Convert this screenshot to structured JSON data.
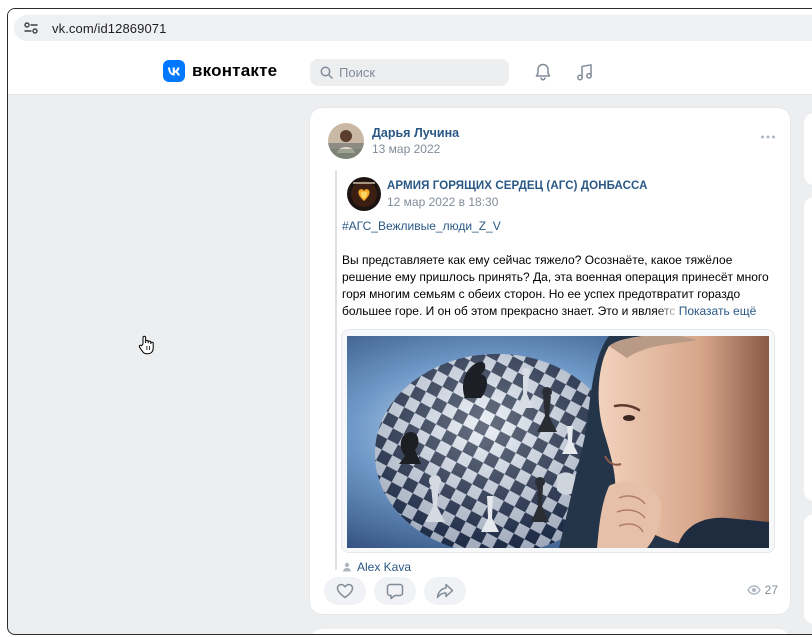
{
  "browser": {
    "url": "vk.com/id12869071"
  },
  "header": {
    "logo_text": "вконтакте",
    "search_placeholder": "Поиск"
  },
  "post": {
    "author": "Дарья Лучина",
    "date": "13 мар 2022",
    "repost": {
      "group_name": "АРМИЯ ГОРЯЩИХ СЕРДЕЦ (АГС) ДОНБАССА",
      "date": "12 мар 2022 в 18:30",
      "hashtag": "#АГС_Вежливые_люди_Z_V",
      "text_main": "Вы представляете как ему сейчас тяжело? Осознаёте, какое тяжёлое решение ему пришлось принять? Да, эта военная операция принесёт много горя многим семьям с обеих сторон. Но ее успех предотвратит гораздо большее горе. И он об этом прекрасно знает. Это и ",
      "text_faded": "являетс",
      "show_more": "Показать ещё",
      "photo_source": "Alex Kava"
    },
    "views": "27"
  },
  "colors": {
    "accent": "#0077ff",
    "link": "#2a5885",
    "page_bg": "#edeef0",
    "muted": "#818c99"
  }
}
